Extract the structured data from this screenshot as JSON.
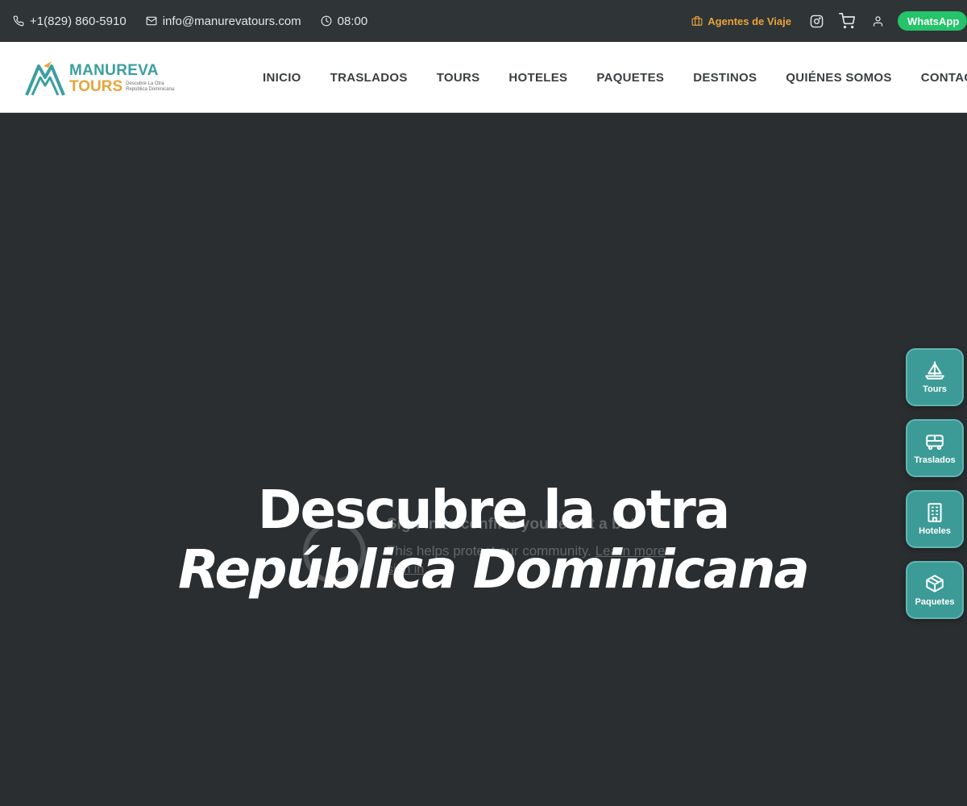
{
  "topbar": {
    "phone": "+1(829) 860-5910",
    "email": "info@manurevatours.com",
    "time": "08:00",
    "agents_label": "Agentes de Viaje",
    "whatsapp_label": "WhatsApp"
  },
  "brand": {
    "name": "MANUREVA",
    "sub": "TOURS",
    "tagline_1": "Descubre La Otra",
    "tagline_2": "República Dominicana"
  },
  "nav": {
    "items": [
      "INICIO",
      "TRASLADOS",
      "TOURS",
      "HOTELES",
      "PAQUETES",
      "DESTINOS",
      "QUIÉNES SOMOS",
      "CONTACTO"
    ]
  },
  "hero": {
    "title_line1": "Descubre la otra",
    "title_line2": "República Dominicana"
  },
  "captcha": {
    "title": "Sign in to confirm you're not a bot",
    "subtitle": "This helps protect our community.",
    "learn_more": "Learn more",
    "sign_in": "sign in"
  },
  "float_buttons": [
    "Tours",
    "Traslados",
    "Hoteles",
    "Paquetes"
  ],
  "colors": {
    "topbar_bg": "#2f3436",
    "brand_teal": "#3c9ea1",
    "brand_orange": "#e8a33b",
    "whatsapp_green": "#25c36a",
    "hero_bg": "#2b2e30",
    "float_btn_bg": "#3d9b97"
  }
}
